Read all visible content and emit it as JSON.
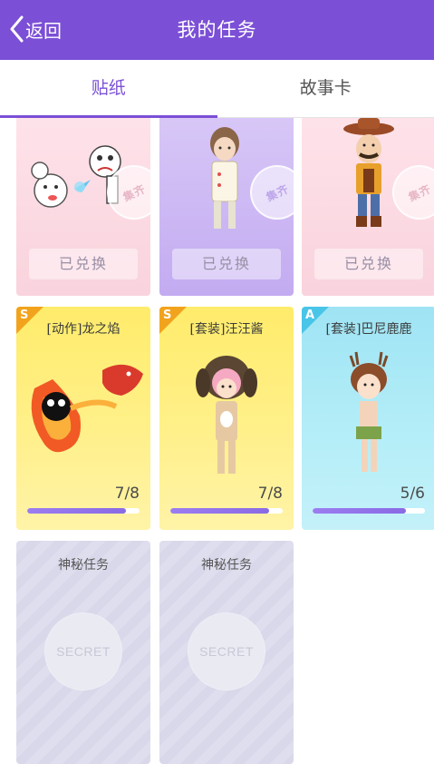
{
  "header": {
    "back_label": "返回",
    "title": "我的任务",
    "bg_color": "#7b4fd6"
  },
  "tabs": [
    {
      "label": "贴纸",
      "active": true
    },
    {
      "label": "故事卡",
      "active": false
    }
  ],
  "collected_cards": [
    {
      "stamp": "集齐",
      "button": "已兑换",
      "art": "cartoon-chefs-splash"
    },
    {
      "stamp": "集齐",
      "button": "已兑换",
      "art": "boy-in-white-coat"
    },
    {
      "stamp": "集齐",
      "button": "已兑换",
      "art": "cowboy-with-mustache"
    }
  ],
  "progress_cards": [
    {
      "grade": "S",
      "name": "[动作]龙之焰",
      "count": "7/8",
      "progress": 0.875,
      "art": "fire-dragon"
    },
    {
      "grade": "S",
      "name": "[套装]汪汪酱",
      "count": "7/8",
      "progress": 0.875,
      "art": "puppy-costume-girl"
    },
    {
      "grade": "A",
      "name": "[套装]巴尼鹿鹿",
      "count": "5/6",
      "progress": 0.833,
      "art": "deer-costume-girl"
    }
  ],
  "secret_cards": [
    {
      "name": "神秘任务",
      "badge": "SECRET"
    },
    {
      "name": "神秘任务",
      "badge": "SECRET"
    }
  ]
}
